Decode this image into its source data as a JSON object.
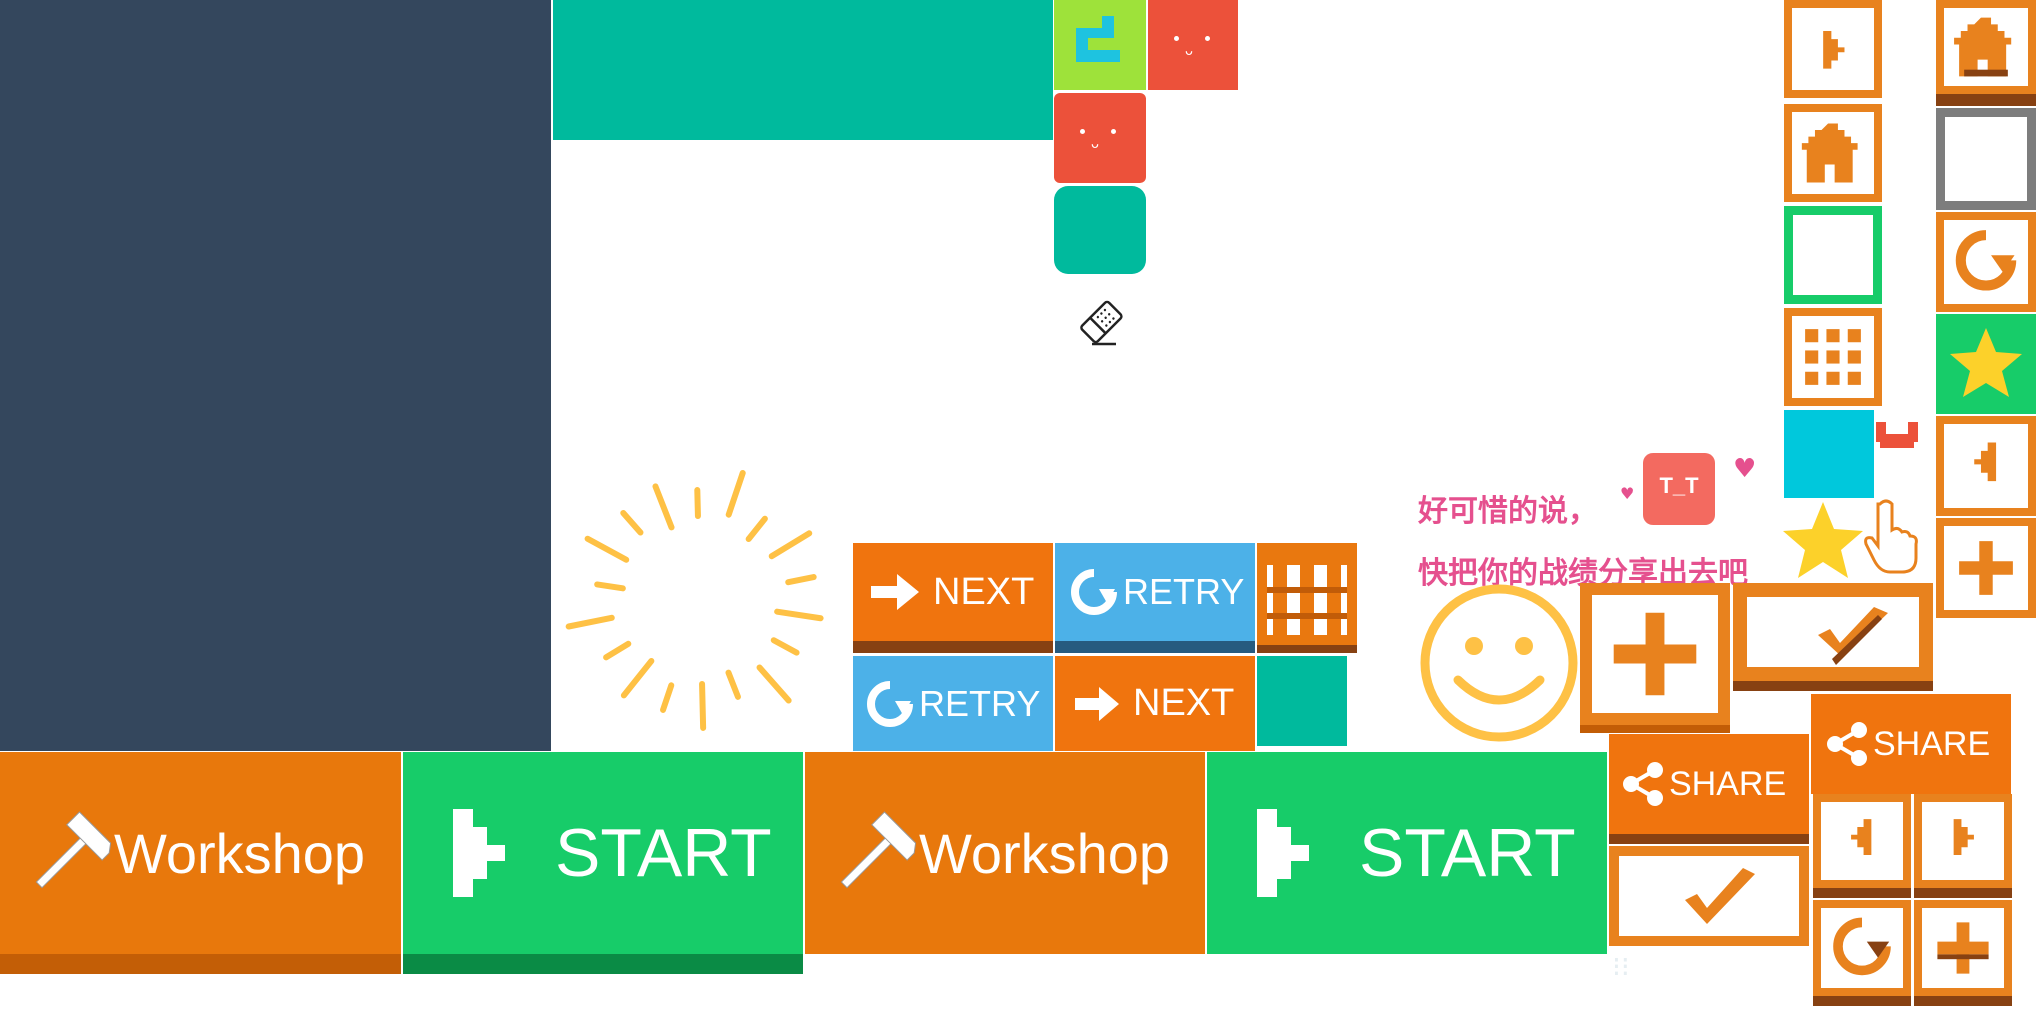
{
  "colors": {
    "dark_panel": "#34475d",
    "teal": "#00ba9d",
    "orange": "#e8780c",
    "orange_shadow": "#c35e06",
    "green": "#17cc69",
    "green_shadow": "#0a8b45",
    "blue": "#4cb1e8",
    "red_face": "#ec513a",
    "cyan": "#00c8dc",
    "yellow_star": "#fcd12a",
    "pink_text": "#e5508e",
    "lime": "#9ee23a"
  },
  "buttons": {
    "workshop_1": "Workshop",
    "start_1": "START",
    "workshop_2": "Workshop",
    "start_2": "START",
    "next_1": "NEXT",
    "retry_1": "RETRY",
    "retry_2": "RETRY",
    "next_2": "NEXT",
    "share_1": "SHARE",
    "share_2": "SHARE"
  },
  "message": {
    "line1": "好可惜的说，",
    "line2": "快把你的战绩分享出去吧"
  },
  "sad_face": "T_T",
  "icons": [
    "hammer-icon",
    "play-icon",
    "arrow-right-icon",
    "retry-icon",
    "share-icon",
    "home-icon",
    "grid-icon",
    "star-icon",
    "plus-icon",
    "check-icon",
    "eraser-icon",
    "smiley-icon",
    "pointer-hand-icon",
    "heart-icon",
    "sunburst-icon"
  ]
}
